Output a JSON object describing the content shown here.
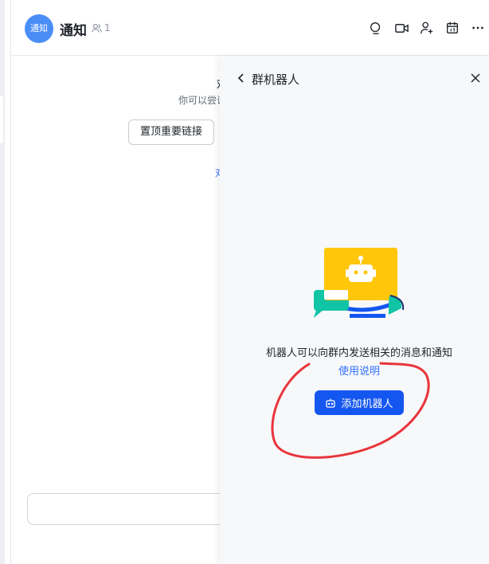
{
  "header": {
    "avatar_text": "通知",
    "title": "通知",
    "member_count": "1",
    "icons": [
      "search-chat-icon",
      "video-call-icon",
      "add-member-icon",
      "calendar-icon",
      "more-icon"
    ]
  },
  "chat": {
    "peek_title_char": "欢",
    "hint_text": "你可以尝试",
    "pin_button": "置顶重要链接",
    "peek_link": "对"
  },
  "panel": {
    "title": "群机器人",
    "description": "机器人可以向群内发送相关的消息和通知",
    "help_link": "使用说明",
    "add_button": "添加机器人"
  },
  "colors": {
    "accent": "#1456f0",
    "link": "#3370ff",
    "avatar": "#4a8df7",
    "robot_yellow": "#ffc60a",
    "annotation_red": "#e8343a"
  }
}
